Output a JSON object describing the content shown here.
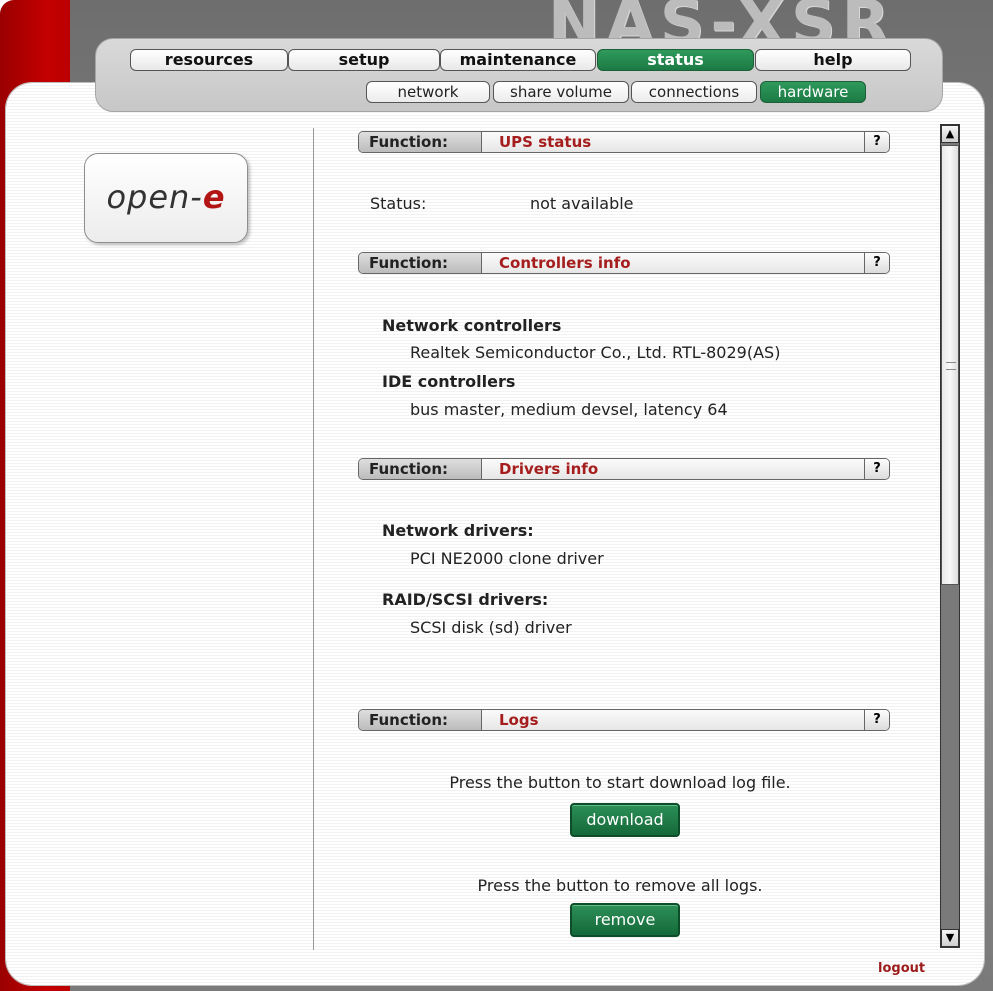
{
  "brand": {
    "title": "NAS-XSR",
    "logo_prefix": "open-",
    "logo_suffix": "e"
  },
  "nav": {
    "tabs": [
      {
        "label": "resources",
        "active": false
      },
      {
        "label": "setup",
        "active": false
      },
      {
        "label": "maintenance",
        "active": false
      },
      {
        "label": "status",
        "active": true
      },
      {
        "label": "help",
        "active": false
      }
    ],
    "subtabs": [
      {
        "label": "network",
        "active": false
      },
      {
        "label": "share volume",
        "active": false
      },
      {
        "label": "connections",
        "active": false
      },
      {
        "label": "hardware",
        "active": true
      }
    ]
  },
  "function_label": "Function:",
  "help_symbol": "?",
  "sections": {
    "ups": {
      "title": "UPS status",
      "status_label": "Status:",
      "status_value": "not available"
    },
    "controllers": {
      "title": "Controllers info",
      "network_heading": "Network controllers",
      "network_value": "Realtek Semiconductor Co., Ltd. RTL-8029(AS)",
      "ide_heading": "IDE controllers",
      "ide_value": "bus master, medium devsel, latency 64"
    },
    "drivers": {
      "title": "Drivers info",
      "network_heading": "Network drivers:",
      "network_value": "PCI NE2000 clone driver",
      "raid_heading": "RAID/SCSI drivers:",
      "raid_value": "SCSI disk (sd) driver"
    },
    "logs": {
      "title": "Logs",
      "download_text": "Press the button to start download log file.",
      "download_label": "download",
      "remove_text": "Press the button to remove all logs.",
      "remove_label": "remove"
    }
  },
  "logout_label": "logout",
  "colors": {
    "accent_green": "#1c7a44",
    "section_title_red": "#a51d1d",
    "frame_red": "#c40000"
  }
}
